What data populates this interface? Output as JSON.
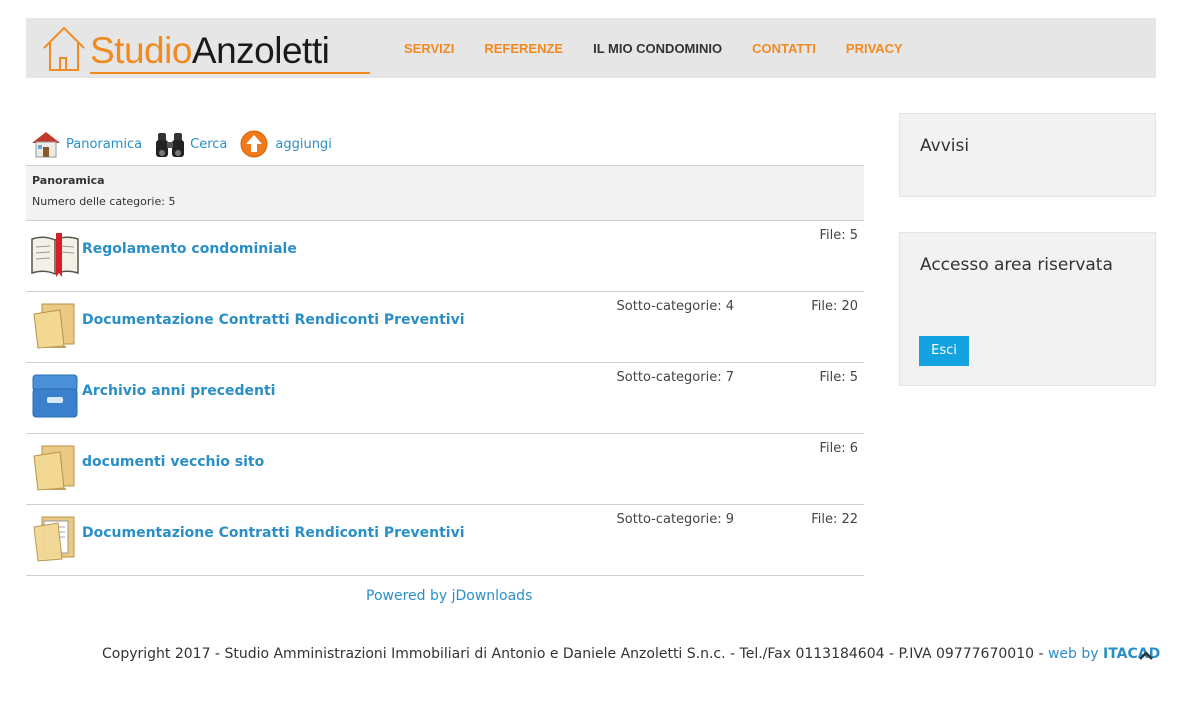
{
  "header": {
    "logo": {
      "part1": "Studio",
      "part2": "Anzoletti"
    },
    "nav": [
      {
        "label": "SERVIZI",
        "active": false
      },
      {
        "label": "REFERENZE",
        "active": false
      },
      {
        "label": "IL MIO CONDOMINIO",
        "active": true
      },
      {
        "label": "CONTATTI",
        "active": false
      },
      {
        "label": "PRIVACY",
        "active": false
      }
    ]
  },
  "toolbar": {
    "overview": "Panoramica",
    "search": "Cerca",
    "add": "aggiungi"
  },
  "list": {
    "head_title": "Panoramica",
    "head_count": "Numero delle categorie: 5",
    "rows": [
      {
        "icon": "book-icon",
        "title": "Regolamento condominiale",
        "subcategories": "",
        "files": "File: 5"
      },
      {
        "icon": "folder-icon",
        "title": "Documentazione Contratti Rendiconti Preventivi",
        "subcategories": "Sotto-categorie: 4",
        "files": "File: 20"
      },
      {
        "icon": "archive-drawer-icon",
        "title": "Archivio anni precedenti",
        "subcategories": "Sotto-categorie: 7",
        "files": "File: 5"
      },
      {
        "icon": "folder-icon",
        "title": "documenti vecchio sito",
        "subcategories": "",
        "files": "File: 6"
      },
      {
        "icon": "folder-documents-icon",
        "title": "Documentazione Contratti Rendiconti Preventivi",
        "subcategories": "Sotto-categorie: 9",
        "files": "File: 22"
      }
    ]
  },
  "powered": "Powered by jDownloads",
  "sidebar": {
    "notices_title": "Avvisi",
    "login_title": "Accesso area riservata",
    "logout_button": "Esci"
  },
  "footer": {
    "copyright": "Copyright 2017 - Studio Amministrazioni Immobiliari di Antonio e Daniele Anzoletti S.n.c.  - Tel./Fax 0113184604 - P.IVA 09777670010 - ",
    "web_by": "web by",
    "itacad": "ITACAD"
  },
  "colors": {
    "brand_orange": "#f28a1f",
    "link_blue": "#2a8fc7",
    "button_blue": "#12a3e0"
  }
}
